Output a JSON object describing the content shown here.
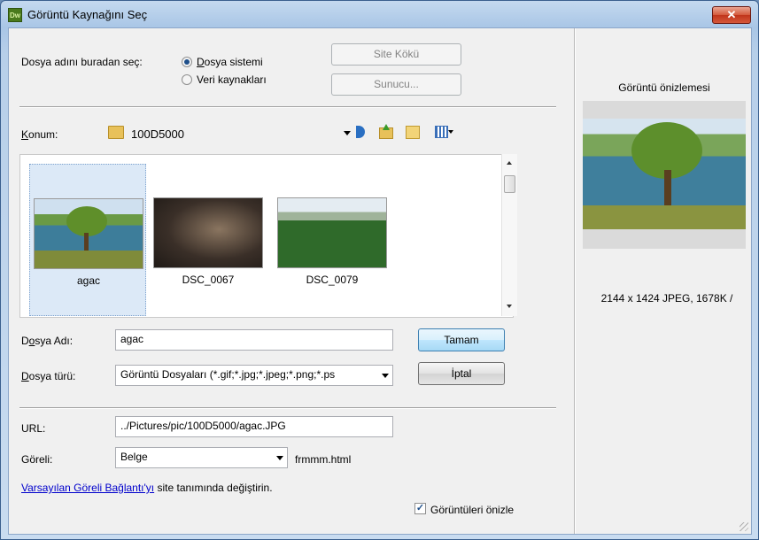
{
  "window": {
    "title": "Görüntü Kaynağını Seç",
    "app_badge": "Dw",
    "close_glyph": "✕"
  },
  "source": {
    "label": "Dosya adını buradan seç:",
    "option_filesystem": "Dosya sistemi",
    "option_datasource": "Veri kaynakları",
    "selected": "Dosya sistemi"
  },
  "buttons": {
    "site_root": "Site Kökü",
    "server": "Sunucu...",
    "ok": "Tamam",
    "cancel": "İptal"
  },
  "location": {
    "label": "Konum:",
    "value": "100D5000"
  },
  "files": [
    {
      "name": "agac",
      "selected": true
    },
    {
      "name": "DSC_0067",
      "selected": false
    },
    {
      "name": "DSC_0079",
      "selected": false
    }
  ],
  "filename": {
    "label": "Dosya Adı:",
    "value": "agac"
  },
  "filetype": {
    "label": "Dosya türü:",
    "value": "Görüntü Dosyaları (*.gif;*.jpg;*.jpeg;*.png;*.ps"
  },
  "url": {
    "label": "URL:",
    "value": "../Pictures/pic/100D5000/agac.JPG"
  },
  "relative": {
    "label": "Göreli:",
    "value": "Belge",
    "doc": "frmmm.html"
  },
  "note": {
    "link": "Varsayılan Göreli Bağlantı'yı",
    "text": " site tanımında değiştirin."
  },
  "preview": {
    "title": "Görüntü önizlemesi",
    "info": "2144 x 1424 JPEG, 1678K /",
    "checkbox_label": "Görüntüleri önizle",
    "checked": true
  }
}
